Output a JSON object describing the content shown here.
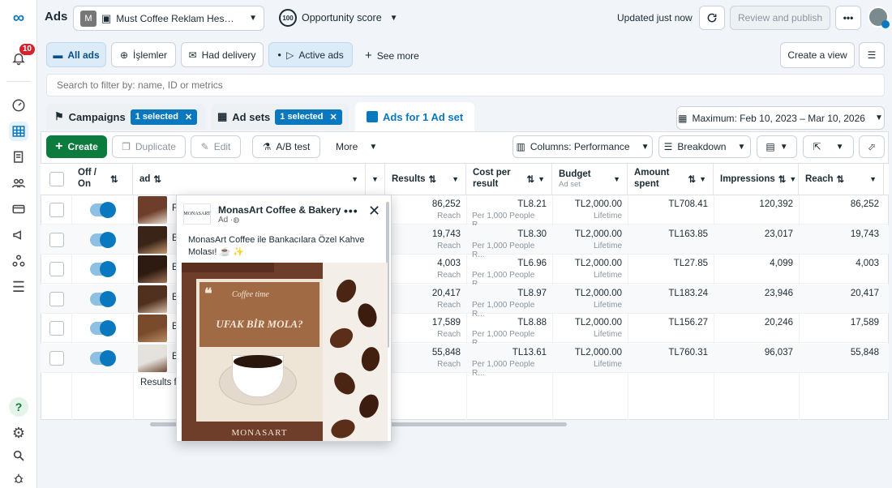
{
  "leftnav": {
    "notifications_count": "10"
  },
  "topbar": {
    "title": "Ads",
    "account_initial": "M",
    "account_name": "Must Coffee Reklam Hes…",
    "opportunity_score": "100",
    "opportunity_label": "Opportunity score",
    "updated_text": "Updated just now",
    "review_publish": "Review and publish",
    "more": "•••"
  },
  "filters": {
    "all_ads": "All ads",
    "islemler": "İşlemler",
    "had_delivery": "Had delivery",
    "active_ads": "Active ads",
    "see_more": "See more",
    "create_view": "Create a view"
  },
  "search": {
    "placeholder": "Search to filter by: name, ID or metrics"
  },
  "tabs": {
    "campaigns": "Campaigns",
    "campaigns_selected": "1 selected",
    "adsets": "Ad sets",
    "adsets_selected": "1 selected",
    "ads": "Ads for 1 Ad set",
    "date_range": "Maximum: Feb 10, 2023 – Mar 10, 2026"
  },
  "toolbar": {
    "create": "Create",
    "duplicate": "Duplicate",
    "edit": "Edit",
    "ab_test": "A/B test",
    "more": "More",
    "columns": "Columns: Performance",
    "breakdown": "Breakdown"
  },
  "columns": {
    "offon": "Off / On",
    "ad": "ad",
    "results": "Results",
    "cost_per_result": "Cost per result",
    "budget": "Budget",
    "budget_sub": "Ad set",
    "amount_spent": "Amount spent",
    "impressions": "Impressions",
    "reach": "Reach"
  },
  "rows": [
    {
      "name": "F",
      "results": "86,252",
      "results_sub": "Reach",
      "cost": "TL8.21",
      "cost_sub": "Per 1,000 People R...",
      "budget": "TL2,000.00",
      "budget_sub": "Lifetime",
      "spent": "TL708.41",
      "impressions": "120,392",
      "reach": "86,252"
    },
    {
      "name": "E",
      "results": "19,743",
      "results_sub": "Reach",
      "cost": "TL8.30",
      "cost_sub": "Per 1,000 People R...",
      "budget": "TL2,000.00",
      "budget_sub": "Lifetime",
      "spent": "TL163.85",
      "impressions": "23,017",
      "reach": "19,743"
    },
    {
      "name": "E",
      "results": "4,003",
      "results_sub": "Reach",
      "cost": "TL6.96",
      "cost_sub": "Per 1,000 People R...",
      "budget": "TL2,000.00",
      "budget_sub": "Lifetime",
      "spent": "TL27.85",
      "impressions": "4,099",
      "reach": "4,003"
    },
    {
      "name": "E",
      "results": "20,417",
      "results_sub": "Reach",
      "cost": "TL8.97",
      "cost_sub": "Per 1,000 People R...",
      "budget": "TL2,000.00",
      "budget_sub": "Lifetime",
      "spent": "TL183.24",
      "impressions": "23,946",
      "reach": "20,417"
    },
    {
      "name": "E",
      "results": "17,589",
      "results_sub": "Reach",
      "cost": "TL8.88",
      "cost_sub": "Per 1,000 People R...",
      "budget": "TL2,000.00",
      "budget_sub": "Lifetime",
      "spent": "TL156.27",
      "impressions": "20,246",
      "reach": "17,589"
    },
    {
      "name": "E",
      "results": "55,848",
      "results_sub": "Reach",
      "cost": "TL13.61",
      "cost_sub": "Per 1,000 People R...",
      "budget": "TL2,000.00",
      "budget_sub": "Lifetime",
      "spent": "TL760.31",
      "impressions": "96,037",
      "reach": "55,848"
    }
  ],
  "results_footer": "Results f",
  "preview": {
    "page_name": "MonasArt Coffee & Bakery",
    "logo_text": "MONASART",
    "sponsored": "Ad · ",
    "caption": "MonasArt Coffee ile Bankacılara Özel Kahve Molası! ☕ ✨",
    "image_script": "Coffee time",
    "image_headline": "UFAK BİR MOLA?",
    "image_brand": "MONASART"
  },
  "colors": {
    "accent": "#0a78be",
    "green": "#0b7b3e",
    "badge": "#d4232c"
  }
}
